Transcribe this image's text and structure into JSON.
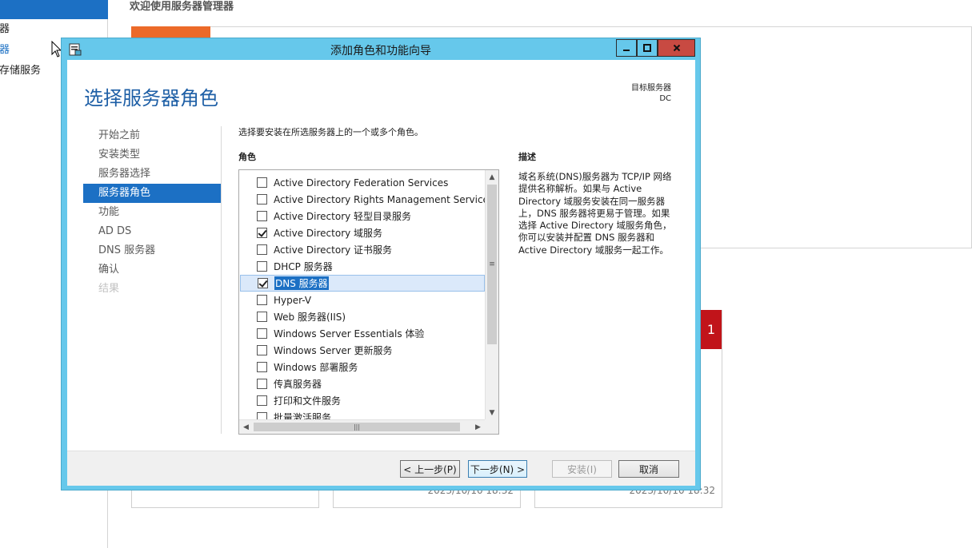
{
  "background": {
    "nav_items": [
      "务器",
      "务器",
      "储存储服务"
    ],
    "welcome_title": "欢迎使用服务器管理器",
    "badge_count": "1",
    "card_dates": [
      "2023/10/10 18:32",
      "2023/10/10 18:32"
    ]
  },
  "window": {
    "title": "添加角色和功能向导",
    "buttons": {
      "minimize": "minimize",
      "maximize": "maximize",
      "close": "close"
    }
  },
  "header": {
    "title": "选择服务器角色",
    "dest_label": "目标服务器",
    "dest_value": "DC"
  },
  "steps": [
    {
      "label": "开始之前",
      "state": "normal"
    },
    {
      "label": "安装类型",
      "state": "normal"
    },
    {
      "label": "服务器选择",
      "state": "normal"
    },
    {
      "label": "服务器角色",
      "state": "active"
    },
    {
      "label": "功能",
      "state": "normal"
    },
    {
      "label": "AD DS",
      "state": "normal"
    },
    {
      "label": "DNS 服务器",
      "state": "normal"
    },
    {
      "label": "确认",
      "state": "normal"
    },
    {
      "label": "结果",
      "state": "disabled"
    }
  ],
  "content": {
    "instruction": "选择要安装在所选服务器上的一个或多个角色。",
    "roles_label": "角色",
    "description_label": "描述",
    "description": "域名系统(DNS)服务器为 TCP/IP 网络提供名称解析。如果与 Active Directory 域服务安装在同一服务器上，DNS 服务器将更易于管理。如果选择 Active Directory 域服务角色，你可以安装并配置 DNS 服务器和 Active Directory 域服务一起工作。"
  },
  "roles": [
    {
      "label": "Active Directory Federation Services",
      "checked": false,
      "selected": false
    },
    {
      "label": "Active Directory Rights Management Services",
      "checked": false,
      "selected": false
    },
    {
      "label": "Active Directory 轻型目录服务",
      "checked": false,
      "selected": false
    },
    {
      "label": "Active Directory 域服务",
      "checked": true,
      "selected": false
    },
    {
      "label": "Active Directory 证书服务",
      "checked": false,
      "selected": false
    },
    {
      "label": "DHCP 服务器",
      "checked": false,
      "selected": false
    },
    {
      "label": "DNS 服务器",
      "checked": true,
      "selected": true
    },
    {
      "label": "Hyper-V",
      "checked": false,
      "selected": false
    },
    {
      "label": "Web 服务器(IIS)",
      "checked": false,
      "selected": false
    },
    {
      "label": "Windows Server Essentials 体验",
      "checked": false,
      "selected": false
    },
    {
      "label": "Windows Server 更新服务",
      "checked": false,
      "selected": false
    },
    {
      "label": "Windows 部署服务",
      "checked": false,
      "selected": false
    },
    {
      "label": "传真服务器",
      "checked": false,
      "selected": false
    },
    {
      "label": "打印和文件服务",
      "checked": false,
      "selected": false
    },
    {
      "label": "批量激活服务",
      "checked": false,
      "selected": false
    }
  ],
  "footer": {
    "prev": "< 上一步(P)",
    "next": "下一步(N) >",
    "install": "安装(I)",
    "cancel": "取消"
  },
  "icons": {
    "scroll_up": "▲",
    "scroll_down": "▼",
    "scroll_left": "◀",
    "scroll_right": "▶",
    "grip_v": "≡",
    "grip_h": "|||"
  }
}
